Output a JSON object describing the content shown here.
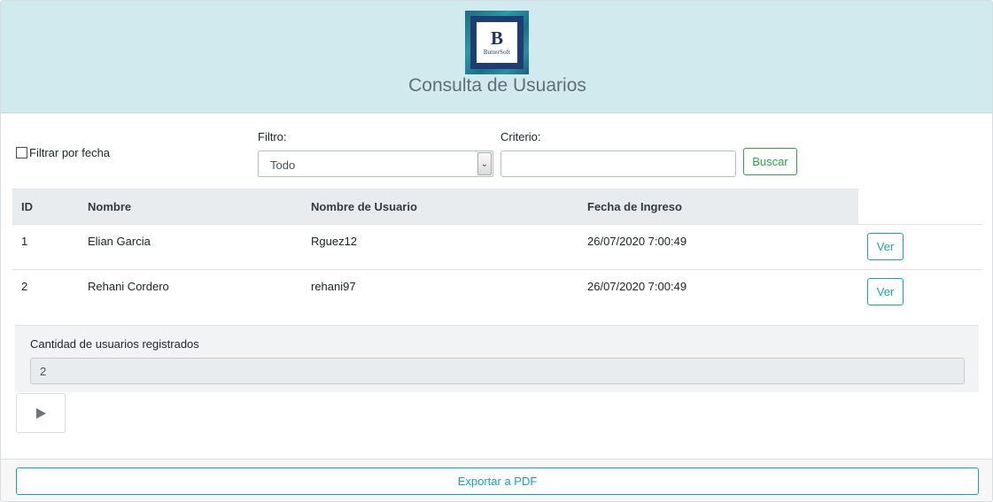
{
  "header": {
    "logo_letter": "B",
    "logo_brand": "ButterSoft",
    "title": "Consulta de Usuarios"
  },
  "filters": {
    "date_filter_label": "Filtrar por fecha",
    "date_filter_checked": false,
    "filtro_label": "Filtro:",
    "filtro_selected": "Todo",
    "criterio_label": "Criterio:",
    "criterio_value": "",
    "search_button": "Buscar"
  },
  "table": {
    "columns": [
      "ID",
      "Nombre",
      "Nombre de Usuario",
      "Fecha de Ingreso"
    ],
    "rows": [
      {
        "id": "1",
        "nombre": "Elian Garcia",
        "usuario": "Rguez12",
        "fecha": "26/07/2020 7:00:49",
        "action": "Ver"
      },
      {
        "id": "2",
        "nombre": "Rehani Cordero",
        "usuario": "rehani97",
        "fecha": "26/07/2020 7:00:49",
        "action": "Ver"
      }
    ]
  },
  "summary": {
    "label": "Cantidad de usuarios registrados",
    "value": "2"
  },
  "controls": {
    "play_icon": "play-icon"
  },
  "footer": {
    "export_button": "Exportar a PDF"
  },
  "colors": {
    "header_bg": "#d1eaee",
    "success": "#28a745",
    "info": "#17a2b8"
  }
}
